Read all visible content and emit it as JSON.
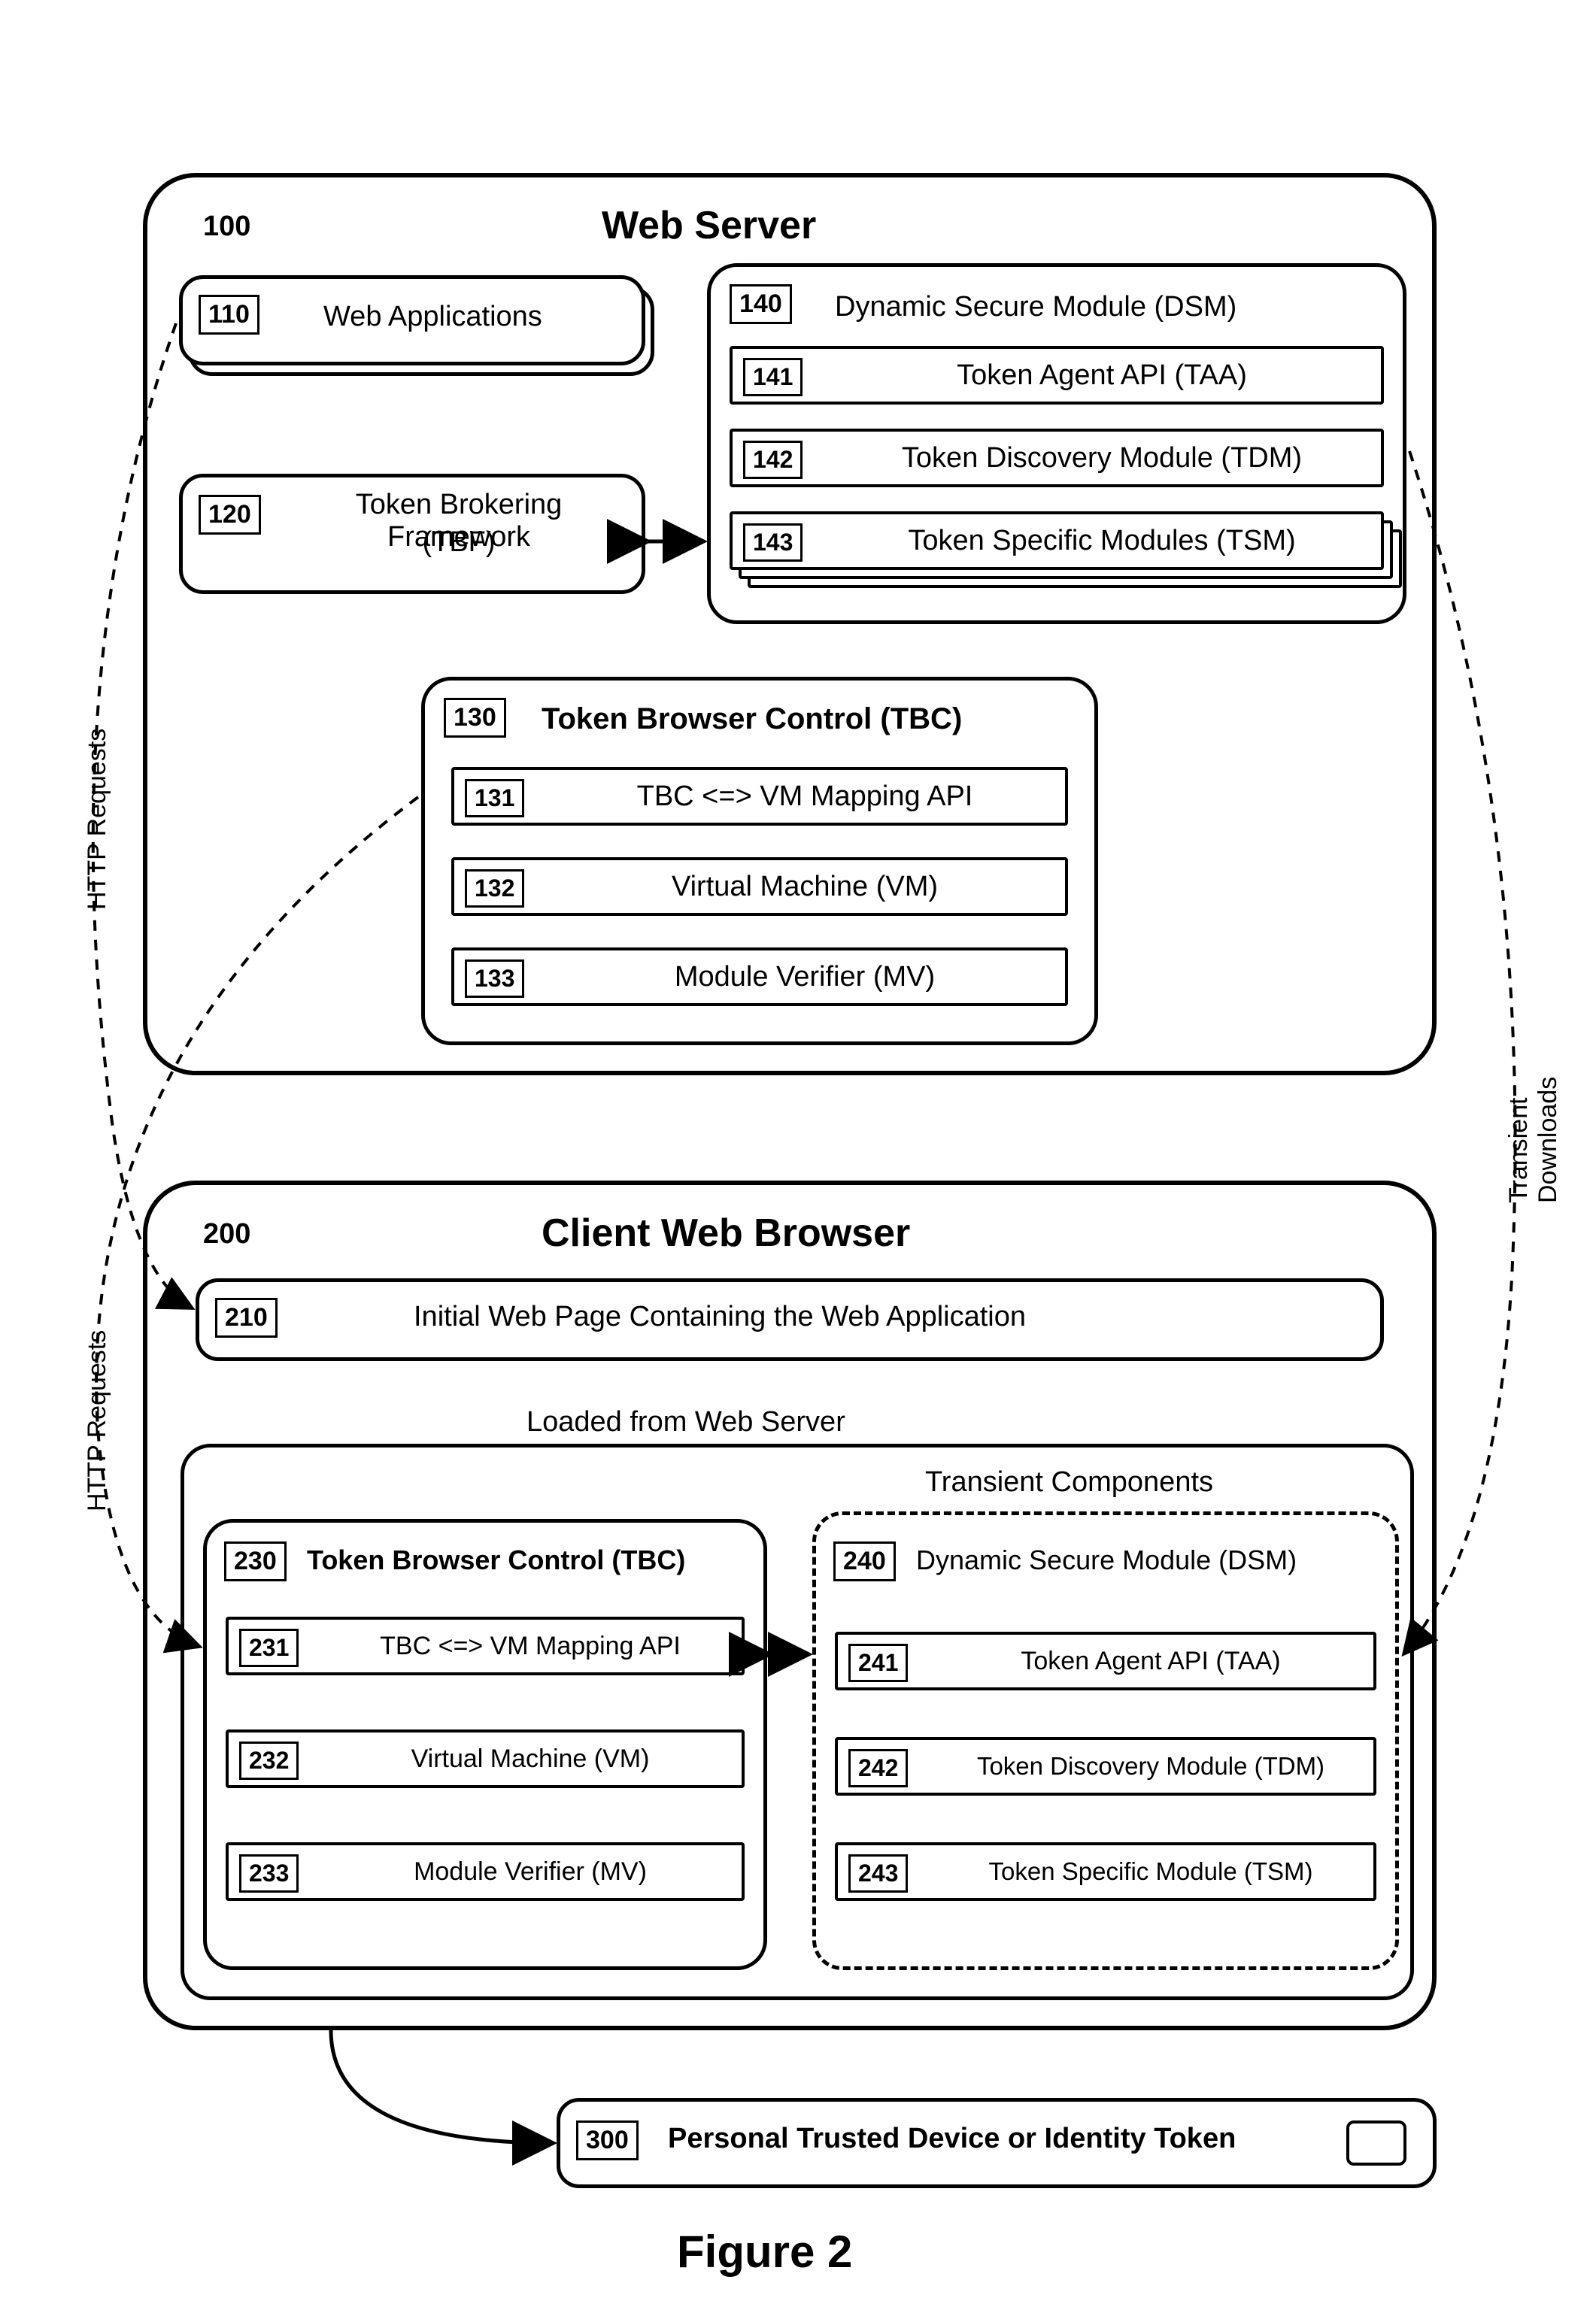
{
  "figure_caption": "Figure 2",
  "server": {
    "ref": "100",
    "title": "Web Server",
    "webapps": {
      "ref": "110",
      "label": "Web Applications"
    },
    "tbf": {
      "ref": "120",
      "label": "Token Brokering Framework",
      "abbr": "(TBF)"
    },
    "tbc": {
      "ref": "130",
      "title": "Token Browser Control (TBC)",
      "items": [
        {
          "ref": "131",
          "label": "TBC <=> VM Mapping API"
        },
        {
          "ref": "132",
          "label": "Virtual Machine (VM)"
        },
        {
          "ref": "133",
          "label": "Module Verifier (MV)"
        }
      ]
    },
    "dsm": {
      "ref": "140",
      "title": "Dynamic Secure Module (DSM)",
      "items": [
        {
          "ref": "141",
          "label": "Token Agent API (TAA)"
        },
        {
          "ref": "142",
          "label": "Token Discovery Module (TDM)"
        },
        {
          "ref": "143",
          "label": "Token Specific Modules (TSM)"
        }
      ]
    }
  },
  "client": {
    "ref": "200",
    "title": "Client Web Browser",
    "page": {
      "ref": "210",
      "label": "Initial Web Page Containing the Web Application"
    },
    "loaded_label": "Loaded from Web Server",
    "transient_label": "Transient Components",
    "tbc": {
      "ref": "230",
      "title": "Token Browser Control (TBC)",
      "items": [
        {
          "ref": "231",
          "label": "TBC <=> VM Mapping API"
        },
        {
          "ref": "232",
          "label": "Virtual Machine (VM)"
        },
        {
          "ref": "233",
          "label": "Module Verifier (MV)"
        }
      ]
    },
    "dsm": {
      "ref": "240",
      "title": "Dynamic Secure Module (DSM)",
      "items": [
        {
          "ref": "241",
          "label": "Token Agent API (TAA)"
        },
        {
          "ref": "242",
          "label": "Token Discovery Module (TDM)"
        },
        {
          "ref": "243",
          "label": "Token Specific Module (TSM)"
        }
      ]
    }
  },
  "device": {
    "ref": "300",
    "label": "Personal Trusted Device or Identity Token"
  },
  "edges": {
    "http_requests": "HTTP Requests",
    "transient_downloads": "Transient Downloads"
  }
}
